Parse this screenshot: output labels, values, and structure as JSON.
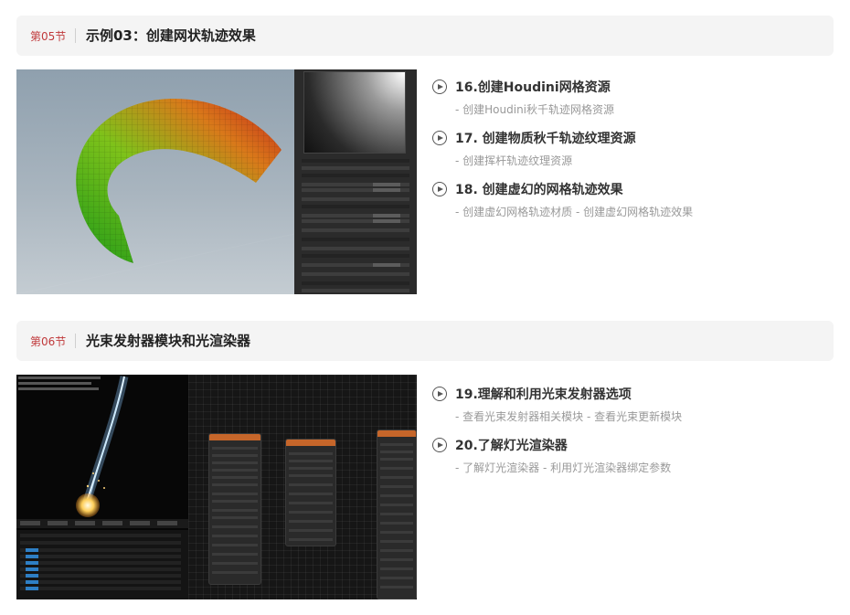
{
  "sections": [
    {
      "number": "第05节",
      "title": "示例03：创建网状轨迹效果",
      "lessons": [
        {
          "title": "16.创建Houdini网格资源",
          "subtitle": "- 创建Houdini秋千轨迹网格资源"
        },
        {
          "title": "17. 创建物质秋千轨迹纹理资源",
          "subtitle": "- 创建挥杆轨迹纹理资源"
        },
        {
          "title": "18. 创建虚幻的网格轨迹效果",
          "subtitle": "- 创建虚幻网格轨迹材质 - 创建虚幻网格轨迹效果"
        }
      ]
    },
    {
      "number": "第06节",
      "title": "光束发射器模块和光渲染器",
      "lessons": [
        {
          "title": "19.理解和利用光束发射器选项",
          "subtitle": "- 查看光束发射器相关模块 - 查看光束更新模块"
        },
        {
          "title": "20.了解灯光渲染器",
          "subtitle": "- 了解灯光渲染器 - 利用灯光渲染器绑定参数"
        }
      ]
    }
  ],
  "colors": {
    "section_number": "#c0393b",
    "header_bg": "#f4f4f4",
    "subtitle": "#999999"
  },
  "icons": {
    "lesson": "play-circle-icon"
  }
}
